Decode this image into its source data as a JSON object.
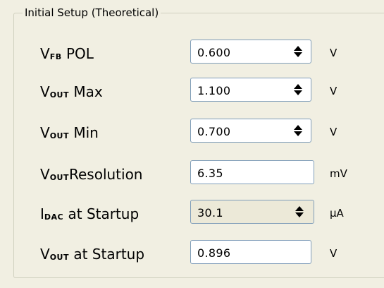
{
  "group": {
    "title": "Initial Setup (Theoretical)"
  },
  "rows": [
    {
      "main": "V",
      "sub": "FB",
      "rest": " POL",
      "value": "0.600",
      "unit": "V"
    },
    {
      "main": "V",
      "sub": "OUT",
      "rest": " Max",
      "value": "1.100",
      "unit": "V"
    },
    {
      "main": "V",
      "sub": "OUT",
      "rest": " Min",
      "value": "0.700",
      "unit": "V"
    },
    {
      "main": "V",
      "sub": "OUT",
      "rest": "Resolution",
      "value": "6.35",
      "unit": "mV"
    },
    {
      "main": "I",
      "sub": "DAC",
      "rest": " at Startup",
      "value": "30.1",
      "unit": "μA"
    },
    {
      "main": "V",
      "sub": "OUT",
      "rest": " at Startup",
      "value": "0.896",
      "unit": "V"
    }
  ]
}
